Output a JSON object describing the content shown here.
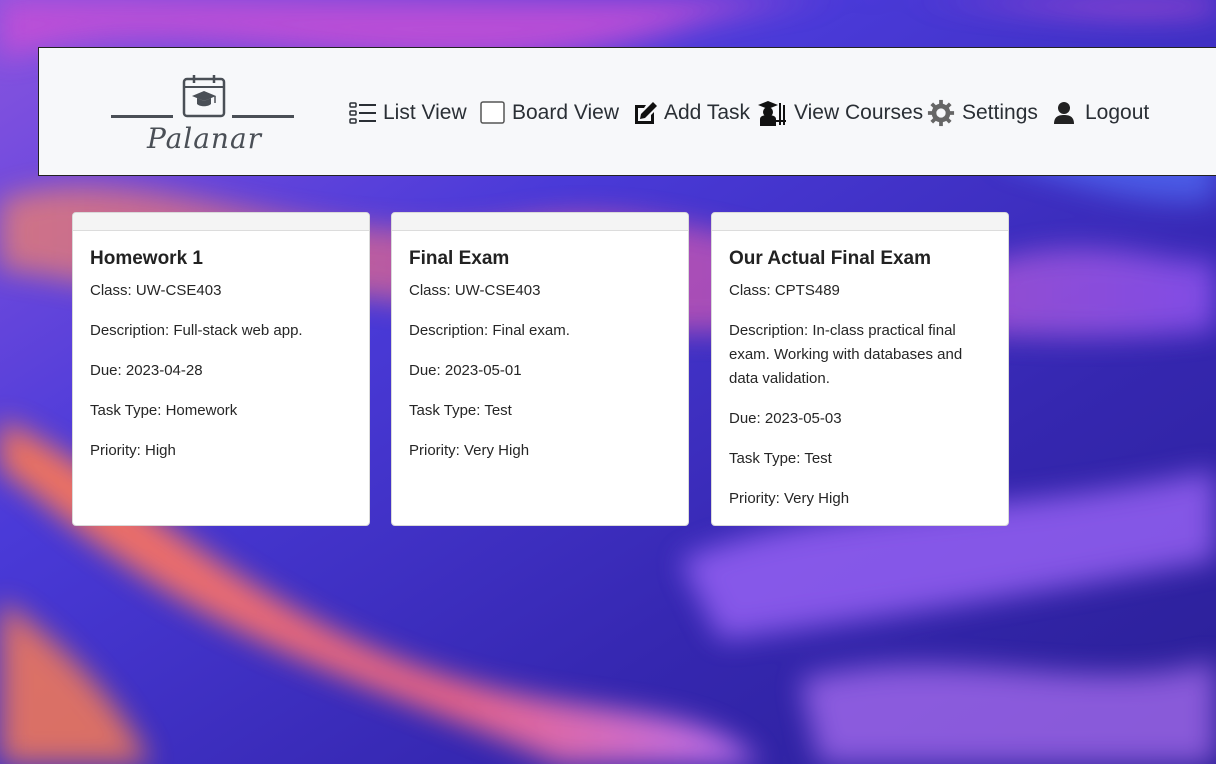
{
  "app": {
    "logo_text": "Palanar"
  },
  "nav": {
    "items": [
      {
        "label": "List View",
        "icon": "list-icon"
      },
      {
        "label": "Board View",
        "icon": "board-icon"
      },
      {
        "label": "Add Task",
        "icon": "edit-icon"
      },
      {
        "label": "View Courses",
        "icon": "teacher-icon"
      },
      {
        "label": "Settings",
        "icon": "gear-icon"
      },
      {
        "label": "Logout",
        "icon": "user-icon"
      }
    ]
  },
  "tasks": [
    {
      "title": "Homework 1",
      "class": "Class: UW-CSE403",
      "description": "Description: Full-stack web app.",
      "due": "Due: 2023-04-28",
      "type": "Task Type: Homework",
      "priority": "Priority: High"
    },
    {
      "title": "Final Exam",
      "class": "Class: UW-CSE403",
      "description": "Description: Final exam.",
      "due": "Due: 2023-05-01",
      "type": "Task Type: Test",
      "priority": "Priority: Very High"
    },
    {
      "title": "Our Actual Final Exam",
      "class": "Class: CPTS489",
      "description": "Description: In-class practical final exam. Working with databases and data validation.",
      "due": "Due: 2023-05-03",
      "type": "Task Type: Test",
      "priority": "Priority: Very High"
    }
  ],
  "colors": {
    "nav_bg": "#f7f8fa",
    "text": "#2a2f35",
    "bg_purple": "#5b3bd8",
    "bg_orange": "#ff7a5a"
  }
}
